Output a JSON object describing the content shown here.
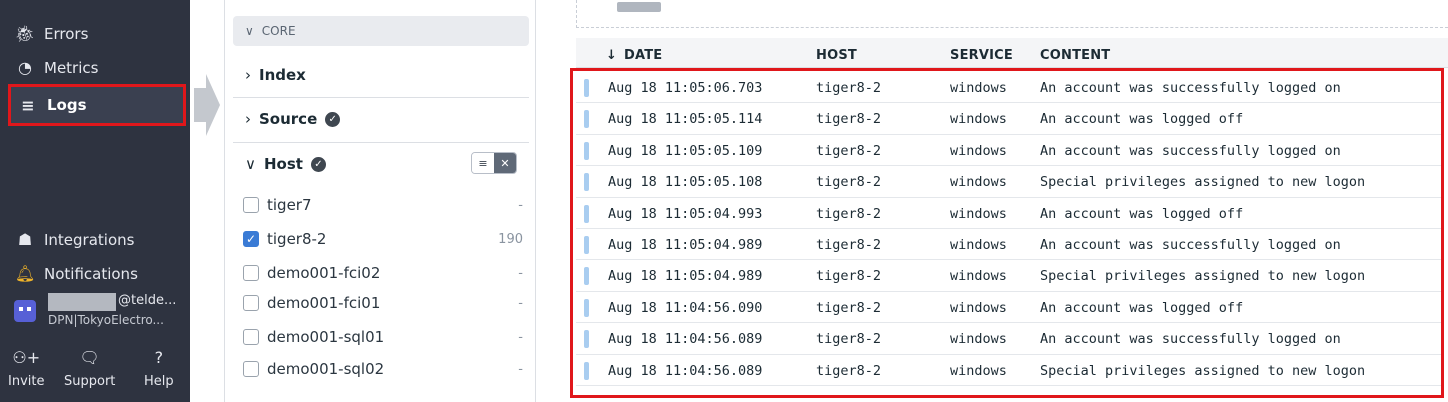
{
  "nav": {
    "errors": "Errors",
    "metrics": "Metrics",
    "logs": "Logs",
    "integrations": "Integrations",
    "notifications": "Notifications",
    "user_email": "@telde...",
    "user_org": "DPN|TokyoElectro...",
    "invite": "Invite",
    "support": "Support",
    "help": "Help"
  },
  "facets": {
    "core": "CORE",
    "index": "Index",
    "source": "Source",
    "host": "Host",
    "hosts": [
      {
        "name": "tiger7",
        "count": "-",
        "checked": false
      },
      {
        "name": "tiger8-2",
        "count": "190",
        "checked": true
      },
      {
        "name": "demo001-fci02",
        "count": "-",
        "checked": false
      },
      {
        "name": "demo001-fci01",
        "count": "-",
        "checked": false
      },
      {
        "name": "demo001-sql01",
        "count": "-",
        "checked": false
      },
      {
        "name": "demo001-sql02",
        "count": "-",
        "checked": false
      }
    ]
  },
  "table": {
    "columns": {
      "date": "DATE",
      "host": "HOST",
      "service": "SERVICE",
      "content": "CONTENT"
    },
    "status_color": "#a9cdf0",
    "rows": [
      {
        "date": "Aug 18 11:05:06.703",
        "host": "tiger8-2",
        "service": "windows",
        "content": "An account was successfully logged on"
      },
      {
        "date": "Aug 18 11:05:05.114",
        "host": "tiger8-2",
        "service": "windows",
        "content": "An account was logged off"
      },
      {
        "date": "Aug 18 11:05:05.109",
        "host": "tiger8-2",
        "service": "windows",
        "content": "An account was successfully logged on"
      },
      {
        "date": "Aug 18 11:05:05.108",
        "host": "tiger8-2",
        "service": "windows",
        "content": "Special privileges assigned to new logon"
      },
      {
        "date": "Aug 18 11:05:04.993",
        "host": "tiger8-2",
        "service": "windows",
        "content": "An account was logged off"
      },
      {
        "date": "Aug 18 11:05:04.989",
        "host": "tiger8-2",
        "service": "windows",
        "content": "An account was successfully logged on"
      },
      {
        "date": "Aug 18 11:05:04.989",
        "host": "tiger8-2",
        "service": "windows",
        "content": "Special privileges assigned to new logon"
      },
      {
        "date": "Aug 18 11:04:56.090",
        "host": "tiger8-2",
        "service": "windows",
        "content": "An account was logged off"
      },
      {
        "date": "Aug 18 11:04:56.089",
        "host": "tiger8-2",
        "service": "windows",
        "content": "An account was successfully logged on"
      },
      {
        "date": "Aug 18 11:04:56.089",
        "host": "tiger8-2",
        "service": "windows",
        "content": "Special privileges assigned to new logon"
      }
    ]
  },
  "colors": {
    "nav_bg": "#2e3340",
    "highlight": "#e0171b",
    "checkbox_on": "#3a7bd5"
  }
}
